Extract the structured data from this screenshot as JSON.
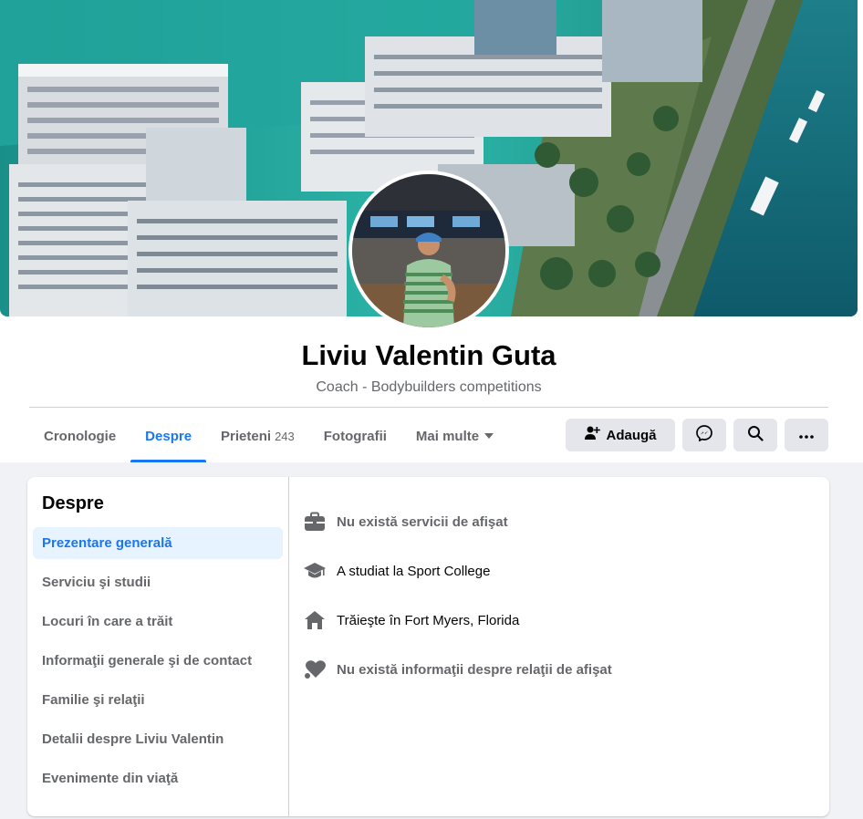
{
  "profile": {
    "name": "Liviu Valentin Guta",
    "subtitle": "Coach - Bodybuilders competitions"
  },
  "tabs": [
    {
      "label": "Cronologie",
      "active": false
    },
    {
      "label": "Despre",
      "active": true
    },
    {
      "label": "Prieteni",
      "count": "243",
      "active": false
    },
    {
      "label": "Fotografii",
      "active": false
    },
    {
      "label": "Mai multe",
      "active": false
    }
  ],
  "actions": {
    "add_label": "Adaugă",
    "add_icon": "add-friend-icon",
    "messenger_icon": "messenger-icon",
    "search_icon": "search-icon",
    "more_icon": "more-icon"
  },
  "about": {
    "title": "Despre",
    "items": [
      "Prezentare generală",
      "Serviciu şi studii",
      "Locuri în care a trăit",
      "Informaţii generale şi de contact",
      "Familie şi relaţii",
      "Detalii despre Liviu Valentin",
      "Evenimente din viaţă"
    ],
    "active_index": 0
  },
  "overview": [
    {
      "text": "Nu există servicii de afişat",
      "icon": "briefcase-icon",
      "muted": true
    },
    {
      "text": "A studiat la Sport College",
      "icon": "graduation-cap-icon",
      "muted": false
    },
    {
      "text": "Trăieşte în Fort Myers, Florida",
      "icon": "home-icon",
      "muted": false
    },
    {
      "text": "Nu există informaţii despre relaţii de afişat",
      "icon": "heart-icon",
      "muted": true
    }
  ],
  "colors": {
    "accent": "#1877f2",
    "secondary_text": "#65676b",
    "button_bg": "#e4e6eb",
    "page_bg": "#f0f2f5"
  }
}
